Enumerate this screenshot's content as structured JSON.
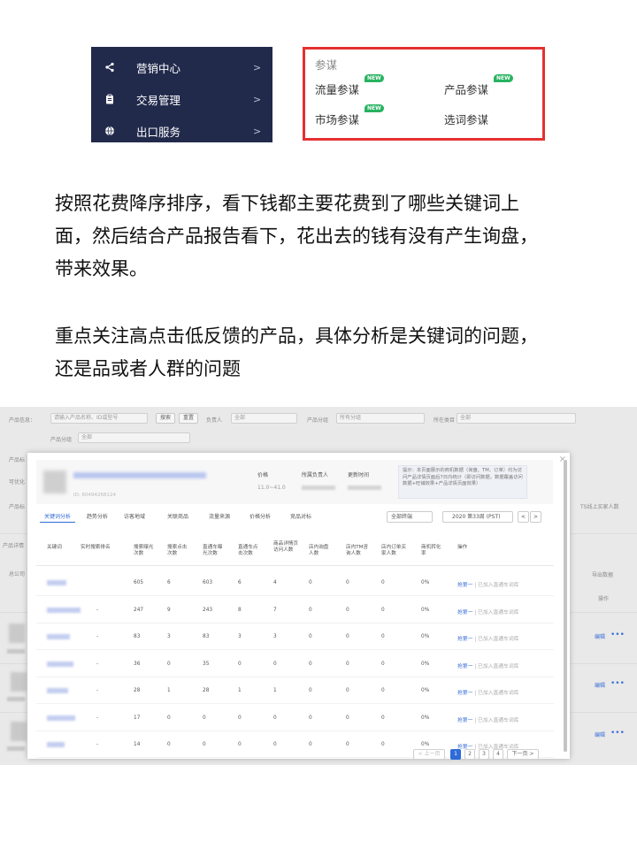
{
  "menu": {
    "items": [
      {
        "icon": "marketing-icon",
        "label": "营销中心",
        "arrow": ">"
      },
      {
        "icon": "clipboard-icon",
        "label": "交易管理",
        "arrow": ">"
      },
      {
        "icon": "globe-icon",
        "label": "出口服务",
        "arrow": ">"
      }
    ]
  },
  "popup": {
    "title": "参谋",
    "items": [
      {
        "label": "流量参谋",
        "tag": "NEW"
      },
      {
        "label": "产品参谋",
        "tag": "NEW"
      },
      {
        "label": "市场参谋",
        "tag": "NEW"
      },
      {
        "label": "选词参谋",
        "tag": ""
      }
    ],
    "border_color": "#e53030",
    "tag_color": "#27b360"
  },
  "paragraphs": [
    {
      "lines": [
        "按照花费降序排序，看下钱都主要花费到了哪些关键词上",
        "面，然后结合产品报告看下，花出去的钱有没有产生询盘，",
        "带来效果。"
      ]
    },
    {
      "lines": [
        "重点关注高点击低反馈的产品，具体分析是关键词的问题，",
        "还是品或者人群的问题"
      ]
    }
  ],
  "background_page": {
    "filters": [
      {
        "label": "产品信息：",
        "placeholder": "请输入产品名称、ID或型号"
      },
      {
        "label": "产品分组",
        "value": "全部"
      }
    ],
    "buttons": {
      "search": "搜索",
      "reset": "重置"
    },
    "owner": {
      "label": "负责人",
      "value": "全部"
    },
    "group": {
      "label": "产品分组",
      "value": "所有分组"
    },
    "category": {
      "label": "所在类目",
      "value": "全部"
    },
    "side_labels": [
      "产品标",
      "可优化",
      "产品标",
      "产品详情",
      "总公司"
    ],
    "right_texts": {
      "buyers": "TS线上买家人数",
      "export": "导出数据",
      "ops": "操作",
      "edit": "编辑"
    }
  },
  "modal": {
    "close": "×",
    "product_id": "ID: 60494268124",
    "price": {
      "label": "价格",
      "value": "11.0~41.0"
    },
    "owner": {
      "label": "所属负责人"
    },
    "updated": {
      "label": "更新时间"
    },
    "hint": "提示：本页面展示的商机数据（询盘、TM、订单）均为访问产品详情页面后7日内统计（即访问数据，数据覆盖访问数据+旺铺效果+产品详情页面效果）",
    "tabs": [
      "关键词分析",
      "趋势分析",
      "访客地域",
      "关联商品",
      "流量来源",
      "价格分析",
      "竞品对标"
    ],
    "channel_select": "全部终端",
    "date_select": "2020 第33周 (PST)",
    "columns": [
      "关键词",
      "实时搜索排名",
      "搜索曝光次数",
      "搜索点击次数",
      "直通车曝光次数",
      "直通车点击次数",
      "商品详情页访问人数",
      "店内询盘人数",
      "店内TM咨询人数",
      "店内订单买家人数",
      "商机转化率",
      "操作"
    ],
    "rows": [
      {
        "rank": "",
        "search_exp": "605",
        "search_click": "6",
        "p4p_exp": "603",
        "p4p_click": "6",
        "visitors": "4",
        "inquiry": "0",
        "tm": "0",
        "orders": "0",
        "rate": "0%",
        "op_link": "抢第一",
        "op_dim": "已加入直通车词库"
      },
      {
        "rank": "-",
        "search_exp": "247",
        "search_click": "9",
        "p4p_exp": "243",
        "p4p_click": "8",
        "visitors": "7",
        "inquiry": "0",
        "tm": "0",
        "orders": "0",
        "rate": "0%",
        "op_link": "抢第一",
        "op_dim": "已加入直通车词库"
      },
      {
        "rank": "-",
        "search_exp": "83",
        "search_click": "3",
        "p4p_exp": "83",
        "p4p_click": "3",
        "visitors": "3",
        "inquiry": "0",
        "tm": "0",
        "orders": "0",
        "rate": "0%",
        "op_link": "抢第一",
        "op_dim": "已加入直通车词库"
      },
      {
        "rank": "-",
        "search_exp": "36",
        "search_click": "0",
        "p4p_exp": "35",
        "p4p_click": "0",
        "visitors": "0",
        "inquiry": "0",
        "tm": "0",
        "orders": "0",
        "rate": "0%",
        "op_link": "抢第一",
        "op_dim": "已加入直通车词库"
      },
      {
        "rank": "-",
        "search_exp": "28",
        "search_click": "1",
        "p4p_exp": "28",
        "p4p_click": "1",
        "visitors": "1",
        "inquiry": "0",
        "tm": "0",
        "orders": "0",
        "rate": "0%",
        "op_link": "抢第一",
        "op_dim": "已加入直通车词库"
      },
      {
        "rank": "-",
        "search_exp": "17",
        "search_click": "0",
        "p4p_exp": "0",
        "p4p_click": "0",
        "visitors": "0",
        "inquiry": "0",
        "tm": "0",
        "orders": "0",
        "rate": "0%",
        "op_link": "抢第一",
        "op_dim": "已加入直通车词库"
      },
      {
        "rank": "-",
        "search_exp": "14",
        "search_click": "0",
        "p4p_exp": "0",
        "p4p_click": "0",
        "visitors": "0",
        "inquiry": "0",
        "tm": "0",
        "orders": "0",
        "rate": "0%",
        "op_link": "抢第一",
        "op_dim": "已加入直通车词库"
      }
    ],
    "pager": {
      "prev": "< 上一页",
      "pages": [
        "1",
        "2",
        "3",
        "4"
      ],
      "current": "1",
      "next": "下一页 >"
    }
  }
}
